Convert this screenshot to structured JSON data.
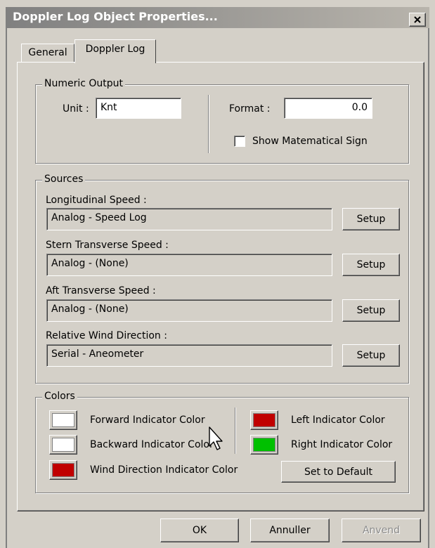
{
  "window": {
    "title": "Doppler Log Object Properties...",
    "close_icon": "close-icon"
  },
  "tabs": [
    {
      "label": "General",
      "active": false
    },
    {
      "label": "Doppler Log",
      "active": true
    }
  ],
  "numeric_output": {
    "title": "Numeric Output",
    "unit_label": "Unit :",
    "unit_value": "Knt",
    "format_label": "Format :",
    "format_value": "0.0",
    "show_sign_label": "Show Matematical Sign",
    "show_sign_checked": false
  },
  "sources": {
    "title": "Sources",
    "setup_label": "Setup",
    "items": [
      {
        "label": "Longitudinal Speed :",
        "value": "Analog - Speed Log"
      },
      {
        "label": "Stern Transverse Speed :",
        "value": "Analog - (None)"
      },
      {
        "label": "Aft Transverse Speed :",
        "value": "Analog - (None)"
      },
      {
        "label": "Relative Wind Direction :",
        "value": "Serial - Aneometer"
      }
    ]
  },
  "colors": {
    "title": "Colors",
    "forward_label": "Forward Indicator Color",
    "forward_color": "#ffffff",
    "backward_label": "Backward Indicator Color",
    "backward_color": "#ffffff",
    "wind_label": "Wind Direction Indicator Color",
    "wind_color": "#c00000",
    "left_label": "Left Indicator Color",
    "left_color": "#c00000",
    "right_label": "Right Indicator Color",
    "right_color": "#00c000",
    "default_button": "Set to Default"
  },
  "footer": {
    "ok": "OK",
    "cancel": "Annuller",
    "apply": "Anvend",
    "apply_enabled": false
  },
  "cursor_icon": "mouse-pointer-icon"
}
